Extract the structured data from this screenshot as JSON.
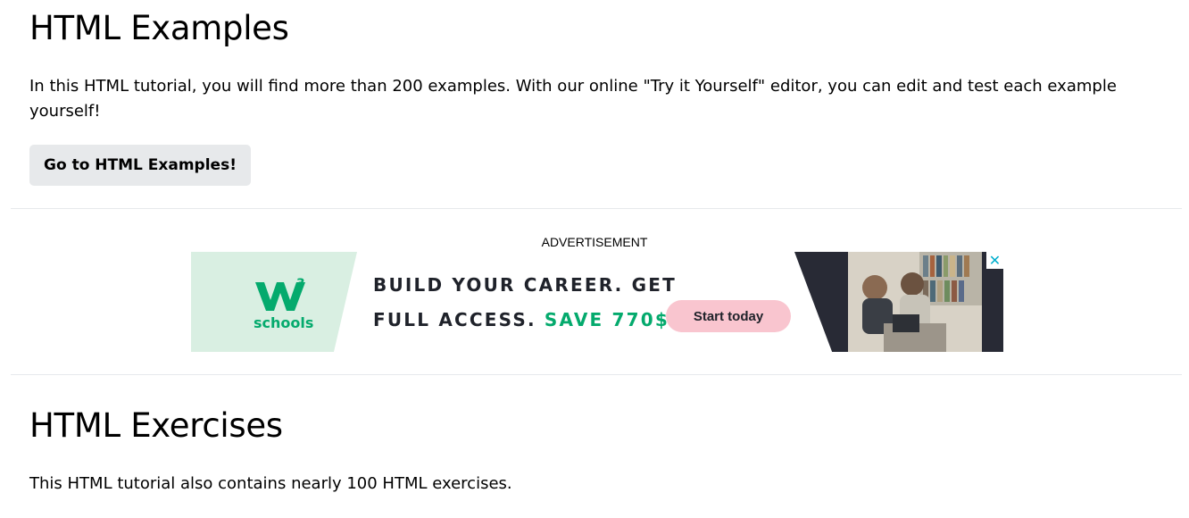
{
  "examples": {
    "title": "HTML Examples",
    "text": "In this HTML tutorial, you will find more than 200 examples. With our online \"Try it Yourself\" editor, you can edit and test each example yourself!",
    "button_label": "Go to HTML Examples!"
  },
  "advertisement": {
    "label": "ADVERTISEMENT",
    "logo_text": "schools",
    "headline_line1": "BUILD YOUR CAREER. GET",
    "headline_line2_part1": "FULL ACCESS. ",
    "headline_line2_accent": "SAVE 770$",
    "cta_label": "Start today",
    "close_icon": "close-icon",
    "colors": {
      "green_bg": "#d9efe2",
      "brand_green": "#04aa6d",
      "cta_pink": "#f9c5cf",
      "dark_navy": "#282a35",
      "close_cyan": "#00aecd"
    }
  },
  "exercises": {
    "title": "HTML Exercises",
    "text": "This HTML tutorial also contains nearly 100 HTML exercises."
  },
  "colors": {
    "button_bg": "#e7e9eb",
    "divider": "#e6e9ec"
  }
}
